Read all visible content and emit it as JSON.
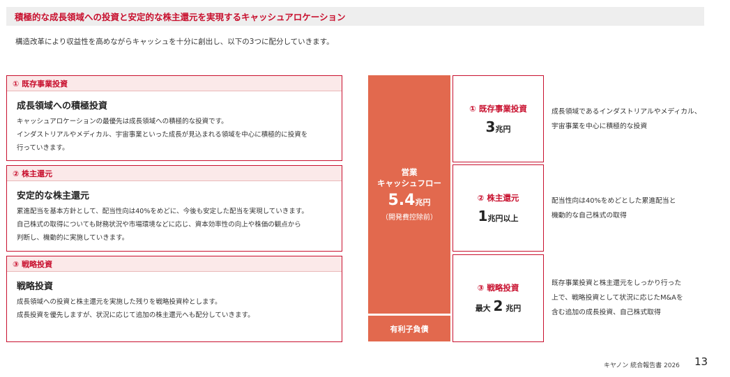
{
  "title": "積極的な成長領域への投資と安定的な株主還元を実現するキャッシュアロケーション",
  "intro": "構造改革により収益性を高めながらキャッシュを十分に創出し、以下の3つに配分していきます。",
  "cards": [
    {
      "head": "① 既存事業投資",
      "title": "成長領域への積極投資",
      "lines": [
        "キャッシュアロケーションの最優先は成長領域への積極的な投資です。",
        "インダストリアルやメディカル、宇宙事業といった成長が見込まれる領域を中心に積極的に投資を",
        "行っていきます。"
      ]
    },
    {
      "head": "② 株主還元",
      "title": "安定的な株主還元",
      "lines": [
        "累進配当を基本方針として、配当性向は40%をめどに、今後も安定した配当を実現していきます。",
        "自己株式の取得についても財務状況や市場環境などに応じ、資本効率性の向上や株価の観点から",
        "判断し、機動的に実施していきます。"
      ]
    },
    {
      "head": "③ 戦略投資",
      "title": "戦略投資",
      "lines": [
        "成長領域への投資と株主還元を実施した残りを戦略投資枠とします。",
        "成長投資を優先しますが、状況に応じて追加の株主還元へも配分していきます。"
      ]
    }
  ],
  "cashflow": {
    "line1": "営業",
    "line2": "キャッシュフロー",
    "amount": "5.4",
    "unit": "兆円",
    "note": "（開発費控除前）"
  },
  "debt": "有利子負債",
  "allocations": [
    {
      "label": "① 既存事業投資",
      "prefix": "",
      "value": "3",
      "unit": "兆円"
    },
    {
      "label": "② 株主還元",
      "prefix": "",
      "value": "1",
      "unit": "兆円以上"
    },
    {
      "label": "③ 戦略投資",
      "prefix": "最大",
      "value": "2",
      "unit": "兆円"
    }
  ],
  "descriptions": [
    [
      "成長領域であるインダストリアルやメディカル、",
      "宇宙事業を中心に積極的な投資"
    ],
    [
      "配当性向は40%をめどとした累進配当と",
      "機動的な自己株式の取得"
    ],
    [
      "既存事業投資と株主還元をしっかり行った",
      "上で、戦略投資として状況に応じたM&Aを",
      "含む追加の成長投資、自己株式取得"
    ]
  ],
  "footer": "キヤノン 統合報告書 2026",
  "page": "13",
  "colors": {
    "accent": "#c8102e",
    "cashflow": "#e2694e",
    "title_bg": "#eeeeee"
  }
}
